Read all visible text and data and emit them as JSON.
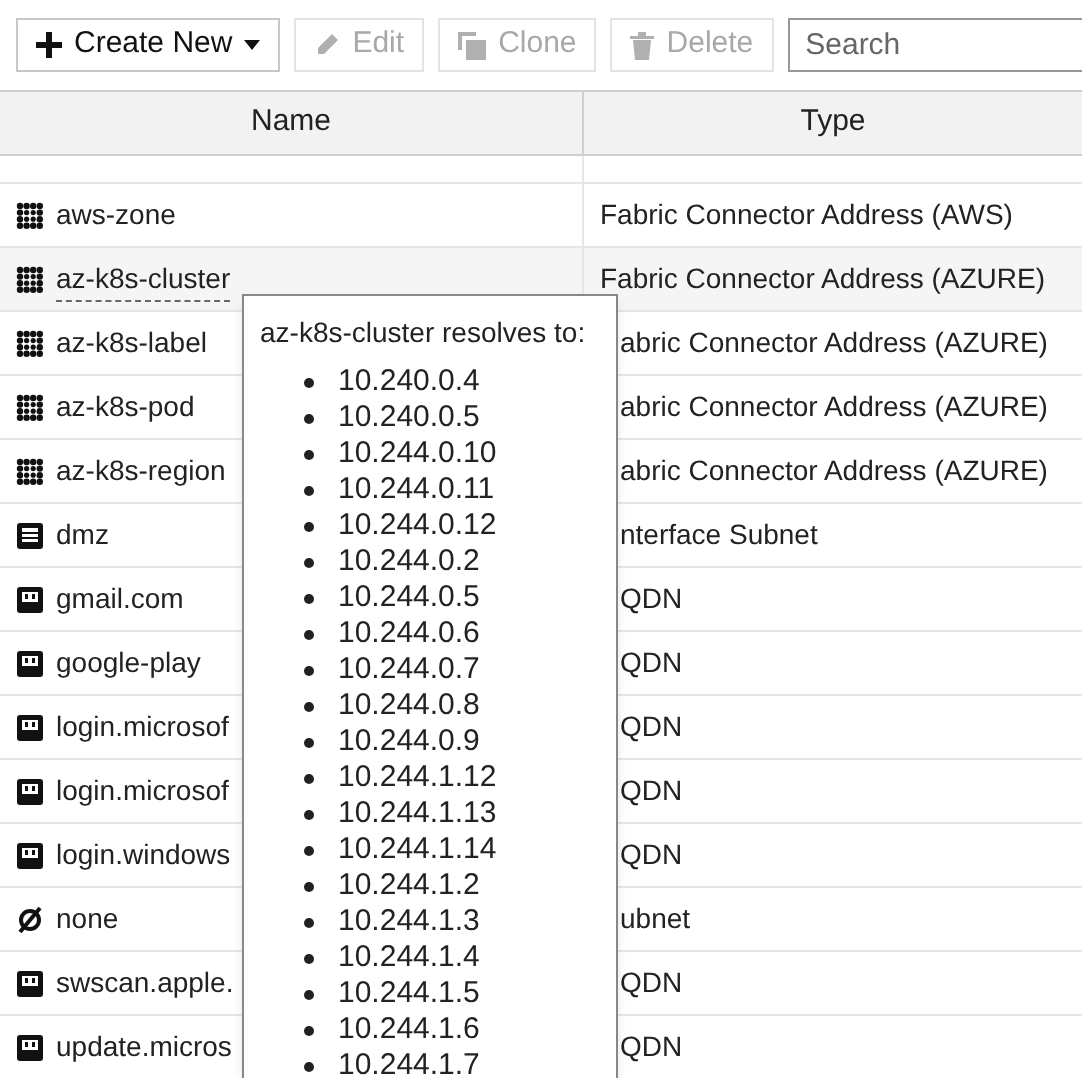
{
  "toolbar": {
    "buttons": [
      {
        "label": "Create New",
        "kind": "create",
        "disabled": false
      },
      {
        "label": "Edit",
        "kind": "edit",
        "disabled": true
      },
      {
        "label": "Clone",
        "kind": "clone",
        "disabled": true
      },
      {
        "label": "Delete",
        "kind": "delete",
        "disabled": true
      }
    ],
    "search": {
      "placeholder": "Search"
    }
  },
  "table": {
    "columns": [
      "Name",
      "Type"
    ],
    "rows": [
      {
        "kind": "connector",
        "name": "aws-zone",
        "type": "Fabric Connector Address (AWS)",
        "selected": false
      },
      {
        "kind": "connector",
        "name": "az-k8s-cluster",
        "type": "Fabric Connector Address (AZURE)",
        "selected": true
      },
      {
        "kind": "connector",
        "name": "az-k8s-label",
        "type": "abric Connector Address (AZURE)",
        "selected": false
      },
      {
        "kind": "connector",
        "name": "az-k8s-pod",
        "type": "abric Connector Address (AZURE)",
        "selected": false
      },
      {
        "kind": "connector",
        "name": "az-k8s-region",
        "type": "abric Connector Address (AZURE)",
        "selected": false
      },
      {
        "kind": "interface",
        "name": "dmz",
        "type": "nterface Subnet",
        "selected": false
      },
      {
        "kind": "fqdn",
        "name": "gmail.com",
        "type": "QDN",
        "selected": false
      },
      {
        "kind": "fqdn",
        "name": "google-play",
        "type": "QDN",
        "selected": false
      },
      {
        "kind": "fqdn",
        "name": "login.microsof",
        "type": "QDN",
        "selected": false
      },
      {
        "kind": "fqdn",
        "name": "login.microsof",
        "type": "QDN",
        "selected": false
      },
      {
        "kind": "fqdn",
        "name": "login.windows",
        "type": "QDN",
        "selected": false
      },
      {
        "kind": "none",
        "name": "none",
        "type": "ubnet",
        "selected": false
      },
      {
        "kind": "fqdn",
        "name": "swscan.apple.",
        "type": "QDN",
        "selected": false
      },
      {
        "kind": "fqdn",
        "name": "update.micros",
        "type": "QDN",
        "selected": false
      }
    ]
  },
  "tooltip": {
    "title": "az-k8s-cluster resolves to:",
    "items": [
      "10.240.0.4",
      "10.240.0.5",
      "10.244.0.10",
      "10.244.0.11",
      "10.244.0.12",
      "10.244.0.2",
      "10.244.0.5",
      "10.244.0.6",
      "10.244.0.7",
      "10.244.0.8",
      "10.244.0.9",
      "10.244.1.12",
      "10.244.1.13",
      "10.244.1.14",
      "10.244.1.2",
      "10.244.1.3",
      "10.244.1.4",
      "10.244.1.5",
      "10.244.1.6",
      "10.244.1.7"
    ]
  }
}
